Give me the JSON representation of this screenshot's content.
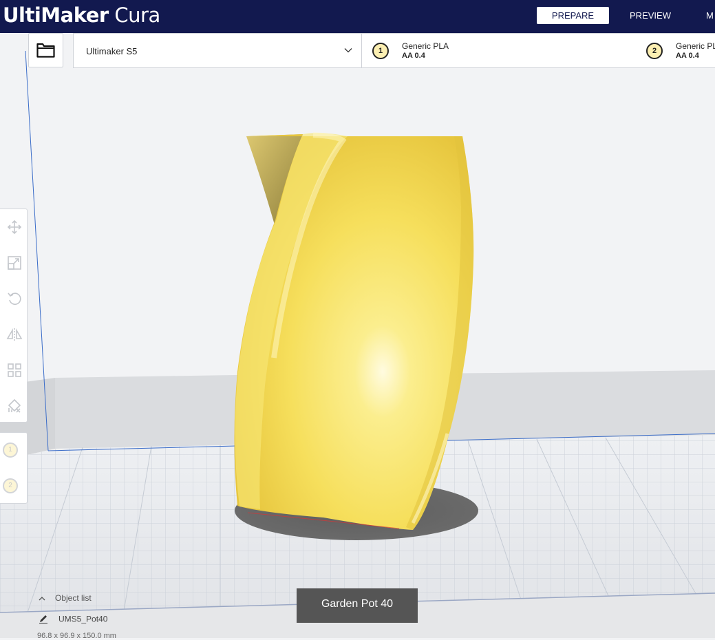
{
  "header": {
    "brand_bold": "UltiMaker",
    "brand_light": "Cura",
    "tabs": [
      "PREPARE",
      "PREVIEW",
      "M"
    ],
    "active_tab": "PREPARE",
    "bg_color": "#12194f"
  },
  "toolbar": {
    "open_icon": "folder-icon",
    "printer": "Ultimaker S5",
    "extruders": [
      {
        "number": "1",
        "material": "Generic PLA",
        "core": "AA 0.4"
      },
      {
        "number": "2",
        "material": "Generic PLA",
        "core": "AA 0.4"
      }
    ]
  },
  "tools": [
    "move-icon",
    "scale-icon",
    "rotate-icon",
    "mirror-icon",
    "per-model-settings-icon",
    "support-blocker-icon"
  ],
  "extruder_buttons": [
    "1",
    "2"
  ],
  "object_list": {
    "title": "Object list",
    "item": "UMS5_Pot40",
    "dimensions": "96.8 x 96.9 x 150.0 mm"
  },
  "tooltip": "Garden Pot 40",
  "colors": {
    "model": "#f7e06a",
    "accent": "#12194f"
  }
}
